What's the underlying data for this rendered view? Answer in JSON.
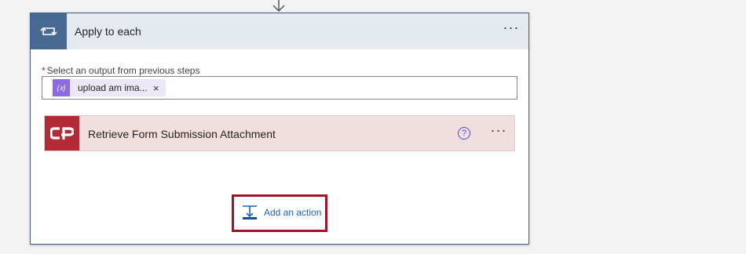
{
  "loop": {
    "title": "Apply to each",
    "menu_label": "···",
    "icon": "loop-icon"
  },
  "output_field": {
    "required_marker": "*",
    "label": "Select an output from previous steps",
    "token": {
      "icon": "expression-icon",
      "icon_glyph": "{𝑥}",
      "text": "upload am ima...",
      "remove_label": "×"
    }
  },
  "action": {
    "title": "Retrieve Form Submission Attachment",
    "icon": "cognito-forms-logo-icon",
    "help_label": "?",
    "menu_label": "···",
    "accent_color": "#b22a35"
  },
  "add_action": {
    "label": "Add an action",
    "icon": "add-action-icon"
  },
  "colors": {
    "loop_accent": "#486991",
    "header_bg": "#e5e9f0",
    "highlight": "#a0142a",
    "link": "#1a63b8"
  }
}
